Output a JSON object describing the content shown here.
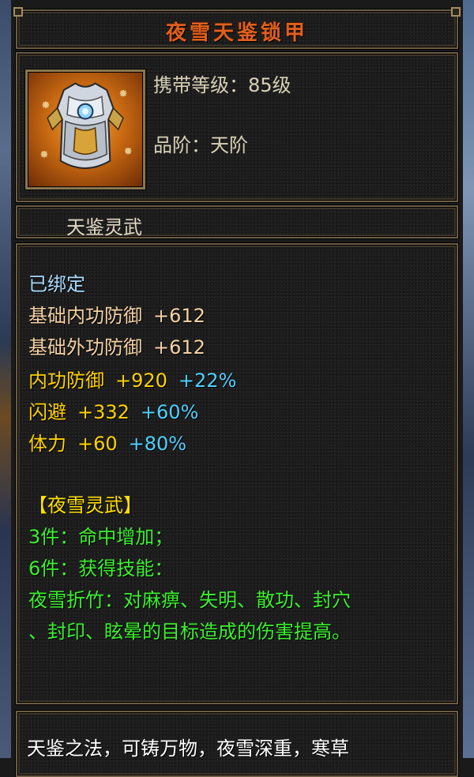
{
  "item": {
    "name": "夜雪天鉴锁甲",
    "level_line": "携带等级：85级",
    "grade_line": "品阶：天阶",
    "series": "天鉴灵武",
    "icon": "armor-chestplate-icon"
  },
  "stats": {
    "bound": "已绑定",
    "base": [
      {
        "label": "基础内功防御",
        "value": "+612"
      },
      {
        "label": "基础外功防御",
        "value": "+612"
      }
    ],
    "bonus": [
      {
        "label": "内功防御",
        "value": "+920",
        "pct": "+22%"
      },
      {
        "label": "闪避",
        "value": "+332",
        "pct": "+60%"
      },
      {
        "label": "体力",
        "value": "+60",
        "pct": "+80%"
      }
    ]
  },
  "set": {
    "name": "【夜雪灵武】",
    "piece3": "3件：命中增加；",
    "piece6": "6件：获得技能：",
    "skill_line1": "夜雪折竹：对麻痹、失明、散功、封穴",
    "skill_line2": "、封印、眩晕的目标造成的伤害提高。"
  },
  "description": "天鉴之法，可铸万物，夜雪深重，寒草",
  "colors": {
    "title": "#e0601e",
    "bound": "#a9dbff",
    "base_stat": "#f5d2a4",
    "bonus_stat": "#ffd200",
    "percent": "#4fd0ff",
    "set_name": "#ffe000",
    "set_effect": "#3cf030",
    "border": "#6b5d45"
  }
}
